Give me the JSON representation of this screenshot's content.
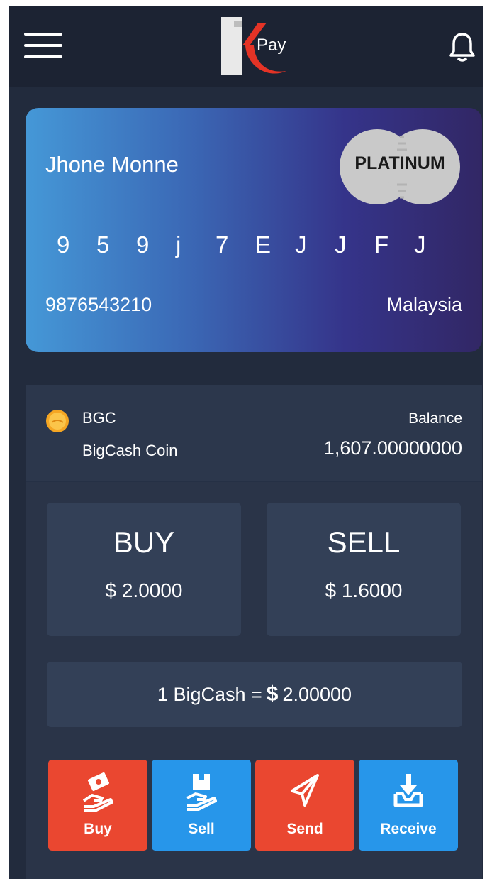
{
  "header": {
    "logo_text": "Pay"
  },
  "card": {
    "holder_name": "Jhone Monne",
    "tier": "PLATINUM",
    "number_chars": [
      "9",
      "5",
      "9",
      "j",
      "7",
      "E",
      "J",
      "J",
      "F",
      "J"
    ],
    "account_id": "9876543210",
    "country": "Malaysia"
  },
  "coin": {
    "symbol": "BGC",
    "name": "BigCash Coin",
    "balance_label": "Balance",
    "balance_value": "1,607.00000000"
  },
  "prices": {
    "buy_label": "BUY",
    "buy_value": "$ 2.0000",
    "sell_label": "SELL",
    "sell_value": "$ 1.6000"
  },
  "rate": {
    "prefix": "1 BigCash =",
    "currency": "$",
    "value": "2.00000"
  },
  "actions": [
    {
      "label": "Buy",
      "icon": "hand-money-icon",
      "color": "#ea4730"
    },
    {
      "label": "Sell",
      "icon": "hand-box-icon",
      "color": "#2796ea"
    },
    {
      "label": "Send",
      "icon": "paper-plane-icon",
      "color": "#ea4730"
    },
    {
      "label": "Receive",
      "icon": "download-tray-icon",
      "color": "#2796ea"
    }
  ],
  "colors": {
    "background": "#222b3d",
    "accent_red": "#ea4730",
    "accent_blue": "#2796ea"
  }
}
